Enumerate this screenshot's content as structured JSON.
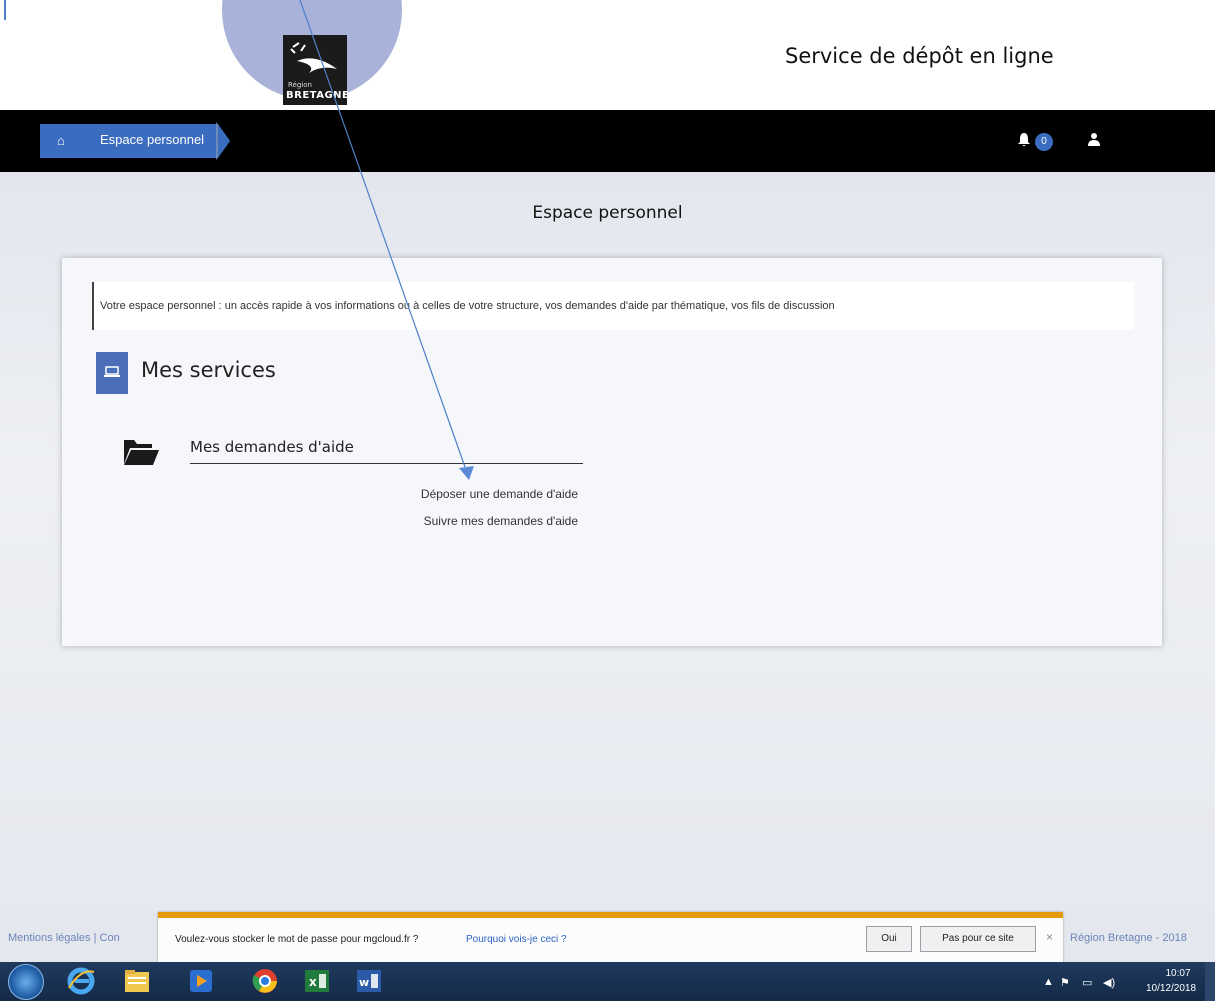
{
  "header": {
    "logo_region": "Région",
    "logo_name": "BRETAGNE",
    "service_title": "Service de dépôt en ligne"
  },
  "navbar": {
    "breadcrumb_label": "Espace personnel",
    "notifications_count": "0"
  },
  "main": {
    "page_title": "Espace personnel",
    "info_text": "Votre espace personnel : un accès rapide à vos informations ou à celles de votre structure, vos demandes d'aide par thématique, vos fils de discussion",
    "services_title": "Mes services",
    "aide_title": "Mes demandes d'aide",
    "link_deposer": "Déposer une demande d'aide",
    "link_suivre": "Suivre mes demandes d'aide"
  },
  "footer": {
    "left_text": "Mentions légales | Con",
    "right_text": "Région Bretagne - 2018"
  },
  "password_bar": {
    "question": "Voulez-vous stocker le mot de passe pour mgcloud.fr ?",
    "why_link": "Pourquoi vois-je ceci ?",
    "yes_label": "Oui",
    "not_for_site_label": "Pas pour ce site",
    "close_symbol": "×"
  },
  "taskbar": {
    "time": "10:07",
    "date": "10/12/2018"
  },
  "colors": {
    "nav_blue": "#3a6cbf",
    "password_bar_accent": "#e59a0c",
    "annotation_arrow": "#4d7fc9"
  },
  "icons": [
    "home-icon",
    "bell-icon",
    "user-icon",
    "laptop-icon",
    "folder-open-icon",
    "windows-start-icon",
    "internet-explorer-icon",
    "file-explorer-icon",
    "media-player-icon",
    "chrome-icon",
    "excel-icon",
    "word-icon"
  ]
}
